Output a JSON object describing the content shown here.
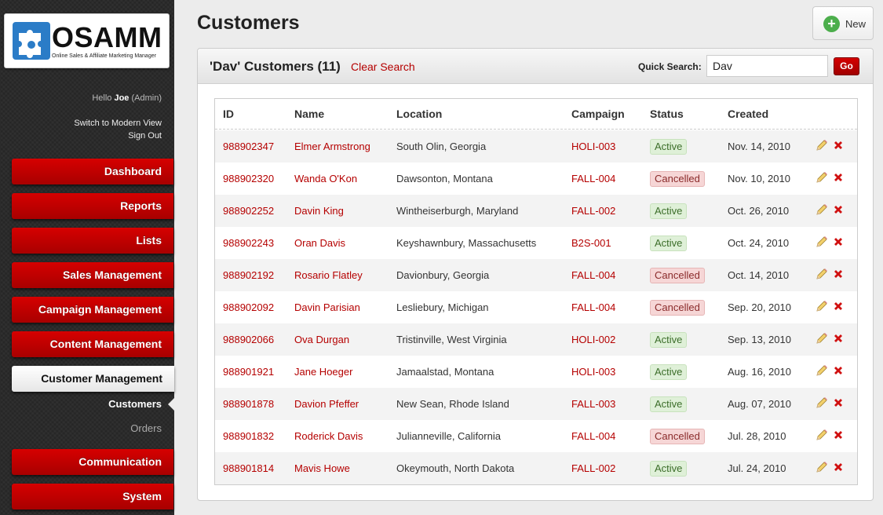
{
  "app": {
    "logo_text": "OSAMM",
    "logo_tagline": "Online Sales & Affiliate Marketing Manager"
  },
  "user": {
    "hello_prefix": "Hello",
    "name": "Joe",
    "role": "(Admin)",
    "switch_view": "Switch to Modern View",
    "sign_out": "Sign Out"
  },
  "nav": {
    "items": [
      {
        "label": "Dashboard"
      },
      {
        "label": "Reports"
      },
      {
        "label": "Lists"
      },
      {
        "label": "Sales Management"
      },
      {
        "label": "Campaign Management"
      },
      {
        "label": "Content Management"
      },
      {
        "label": "Customer Management"
      },
      {
        "label": "Communication"
      },
      {
        "label": "System"
      }
    ],
    "sub_items": [
      {
        "label": "Customers"
      },
      {
        "label": "Orders"
      }
    ]
  },
  "page": {
    "title": "Customers",
    "new_label": "New"
  },
  "panel": {
    "title": "'Dav' Customers (11)",
    "clear_search": "Clear Search",
    "quick_search_label": "Quick Search:",
    "search_value": "Dav",
    "go_label": "Go"
  },
  "table": {
    "headers": [
      "ID",
      "Name",
      "Location",
      "Campaign",
      "Status",
      "Created"
    ],
    "rows": [
      {
        "id": "988902347",
        "name": "Elmer Armstrong",
        "location": "South Olin, Georgia",
        "campaign": "HOLI-003",
        "status": "Active",
        "created": "Nov. 14, 2010"
      },
      {
        "id": "988902320",
        "name": "Wanda O'Kon",
        "location": "Dawsonton, Montana",
        "campaign": "FALL-004",
        "status": "Cancelled",
        "created": "Nov. 10, 2010"
      },
      {
        "id": "988902252",
        "name": "Davin King",
        "location": "Wintheiserburgh, Maryland",
        "campaign": "FALL-002",
        "status": "Active",
        "created": "Oct. 26, 2010"
      },
      {
        "id": "988902243",
        "name": "Oran Davis",
        "location": "Keyshawnbury, Massachusetts",
        "campaign": "B2S-001",
        "status": "Active",
        "created": "Oct. 24, 2010"
      },
      {
        "id": "988902192",
        "name": "Rosario Flatley",
        "location": "Davionbury, Georgia",
        "campaign": "FALL-004",
        "status": "Cancelled",
        "created": "Oct. 14, 2010"
      },
      {
        "id": "988902092",
        "name": "Davin Parisian",
        "location": "Lesliebury, Michigan",
        "campaign": "FALL-004",
        "status": "Cancelled",
        "created": "Sep. 20, 2010"
      },
      {
        "id": "988902066",
        "name": "Ova Durgan",
        "location": "Tristinville, West Virginia",
        "campaign": "HOLI-002",
        "status": "Active",
        "created": "Sep. 13, 2010"
      },
      {
        "id": "988901921",
        "name": "Jane Hoeger",
        "location": "Jamaalstad, Montana",
        "campaign": "HOLI-003",
        "status": "Active",
        "created": "Aug. 16, 2010"
      },
      {
        "id": "988901878",
        "name": "Davion Pfeffer",
        "location": "New Sean, Rhode Island",
        "campaign": "FALL-003",
        "status": "Active",
        "created": "Aug. 07, 2010"
      },
      {
        "id": "988901832",
        "name": "Roderick Davis",
        "location": "Julianneville, California",
        "campaign": "FALL-004",
        "status": "Cancelled",
        "created": "Jul. 28, 2010"
      },
      {
        "id": "988901814",
        "name": "Mavis Howe",
        "location": "Okeymouth, North Dakota",
        "campaign": "FALL-002",
        "status": "Active",
        "created": "Jul. 24, 2010"
      }
    ]
  },
  "icons": {
    "edit": "pencil-icon",
    "delete": "delete-x-icon",
    "new": "plus-circle-icon",
    "logo": "puzzle-icon"
  },
  "colors": {
    "brand_red": "#b50000",
    "active_badge": "#dff0d8",
    "cancelled_badge": "#f6d6d6"
  }
}
